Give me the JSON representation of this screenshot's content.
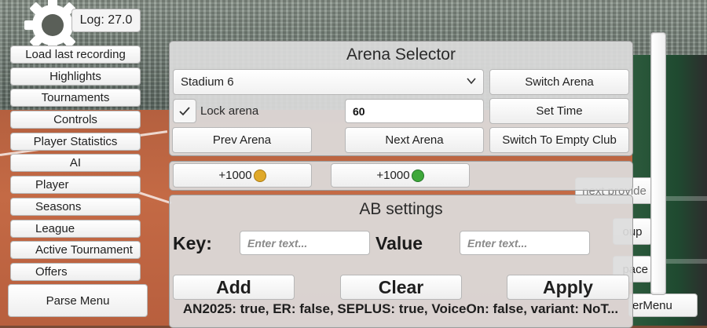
{
  "log": {
    "text": "Log: 27.0"
  },
  "sidebar": {
    "items": [
      {
        "label": "Load last recording"
      },
      {
        "label": "Highlights"
      },
      {
        "label": "Tournaments"
      },
      {
        "label": "Controls"
      },
      {
        "label": "Player Statistics"
      },
      {
        "label": "AI"
      },
      {
        "label": "Player"
      },
      {
        "label": "Seasons"
      },
      {
        "label": "League"
      },
      {
        "label": "Active Tournament"
      },
      {
        "label": "Offers"
      }
    ],
    "parse_menu": "Parse Menu"
  },
  "arena": {
    "title": "Arena Selector",
    "selected_stadium": "Stadium 6",
    "switch_arena": "Switch Arena",
    "lock_arena": "Lock arena",
    "lock_checked": true,
    "time_value": "60",
    "set_time": "Set Time",
    "prev_arena": "Prev Arena",
    "next_arena": "Next Arena",
    "switch_empty_club": "Switch To Empty Club"
  },
  "currency": {
    "coins_button": "+1000",
    "gems_button": "+1000",
    "coin_color": "#e0a92a",
    "gem_color": "#3ea83a"
  },
  "ab_settings": {
    "title": "AB settings",
    "key_label": "Key:",
    "key_placeholder": "Enter text...",
    "value_label": "Value",
    "value_placeholder": "Enter text...",
    "add": "Add",
    "clear": "Clear",
    "apply": "Apply",
    "info": "AN2025: true, ER: false, SEPLUS: true, VoiceOn: false, variant: NoT..."
  },
  "behind": {
    "next_provider": "next provide",
    "group": "oup",
    "space": "pace",
    "menu": "erMenu"
  },
  "colors": {
    "panel_bg": "#dcdcdc",
    "button_bg": "#ffffff",
    "court": "#c46a45"
  }
}
